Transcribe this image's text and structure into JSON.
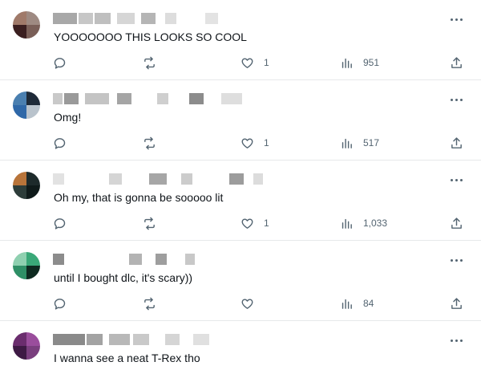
{
  "replies": [
    {
      "text": "YOOOOOOO THIS LOOKS SO COOL",
      "likes": "1",
      "views": "951",
      "avatar_colors": [
        "#a07a6a",
        "#9e8a82",
        "#3b1f20",
        "#7a5f58"
      ],
      "name_colors": [
        "#a8a8a8",
        "#c7c7c7",
        "#bfbfbf",
        "#d6d6d6",
        "#b5b5b5",
        "#dddddd",
        "#e3e3e3"
      ]
    },
    {
      "text": "Omg!",
      "likes": "1",
      "views": "517",
      "avatar_colors": [
        "#4a7fb0",
        "#1e2a38",
        "#2f68a8",
        "#b9c3cc"
      ],
      "name_colors": [
        "#c9c9c9",
        "#9a9a9a",
        "#c4c4c4",
        "#a5a5a5",
        "#cfcfcf",
        "#8c8c8c",
        "#dedede"
      ]
    },
    {
      "text": "Oh my, that is gonna be sooooo lit",
      "likes": "1",
      "views": "1,033",
      "avatar_colors": [
        "#b8743a",
        "#1d2a2b",
        "#2d3d3a",
        "#0f1a1a"
      ],
      "name_colors": [
        "#e2e2e2",
        "#d5d5d5",
        "#a6a6a6",
        "#cccccc",
        "#9c9c9c",
        "#dcdcdc"
      ]
    },
    {
      "text": "until I bought dlc, it's scary))",
      "likes": "",
      "views": "84",
      "avatar_colors": [
        "#8fd0b0",
        "#3aa878",
        "#2f8f66",
        "#0e2a20"
      ],
      "name_colors": [
        "#8c8c8c",
        "#b3b3b3",
        "#9e9e9e",
        "#c8c8c8"
      ]
    },
    {
      "text": "I wanna see a neat T-Rex tho",
      "likes": "",
      "views": "",
      "avatar_colors": [
        "#6b2d6e",
        "#9a4d9c",
        "#3e1a44",
        "#7a3f7e"
      ],
      "name_colors": [
        "#8a8a8a",
        "#a3a3a3",
        "#b8b8b8",
        "#c9c9c9",
        "#d5d5d5",
        "#e0e0e0"
      ]
    }
  ]
}
